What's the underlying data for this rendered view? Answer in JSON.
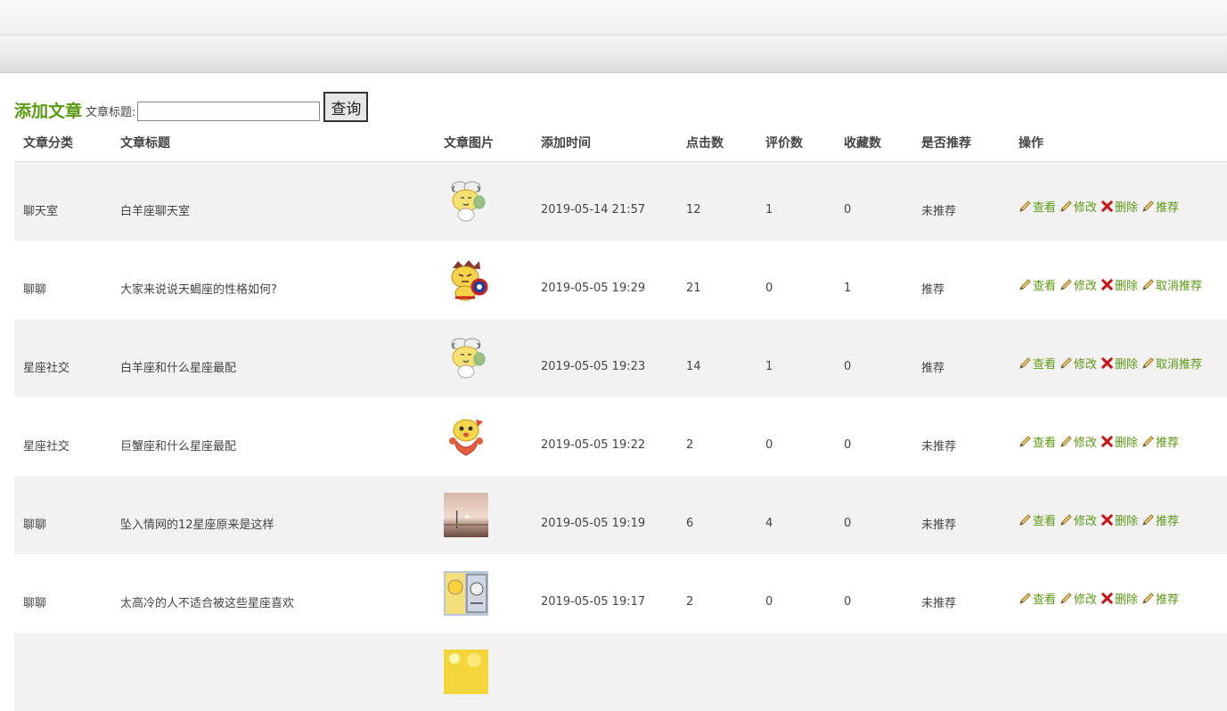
{
  "toolbar": {
    "add_article": "添加文章",
    "search_label": "文章标题:",
    "search_value": "",
    "search_button": "查询"
  },
  "columns": [
    "文章分类",
    "文章标题",
    "文章图片",
    "添加时间",
    "点击数",
    "评价数",
    "收藏数",
    "是否推荐",
    "操作"
  ],
  "rows": [
    {
      "category": "聊天室",
      "title": "白羊座聊天室",
      "image": "sheep-cartoon",
      "time": "2019-05-14 21:57",
      "clicks": "12",
      "reviews": "1",
      "favorites": "0",
      "recommended": "未推荐",
      "ops": [
        "查看",
        "修改",
        "删除",
        "推荐"
      ]
    },
    {
      "category": "聊聊",
      "title": "大家来说说天蝎座的性格如何?",
      "image": "captain-cartoon",
      "time": "2019-05-05 19:29",
      "clicks": "21",
      "reviews": "0",
      "favorites": "1",
      "recommended": "推荐",
      "ops": [
        "查看",
        "修改",
        "删除",
        "取消推荐"
      ]
    },
    {
      "category": "星座社交",
      "title": "白羊座和什么星座最配",
      "image": "sheep-cartoon",
      "time": "2019-05-05 19:23",
      "clicks": "14",
      "reviews": "1",
      "favorites": "0",
      "recommended": "推荐",
      "ops": [
        "查看",
        "修改",
        "删除",
        "取消推荐"
      ]
    },
    {
      "category": "星座社交",
      "title": "巨蟹座和什么星座最配",
      "image": "crab-cartoon",
      "time": "2019-05-05 19:22",
      "clicks": "2",
      "reviews": "0",
      "favorites": "0",
      "recommended": "未推荐",
      "ops": [
        "查看",
        "修改",
        "删除",
        "推荐"
      ]
    },
    {
      "category": "聊聊",
      "title": "坠入情网的12星座原来是这样",
      "image": "sunset-photo",
      "time": "2019-05-05 19:19",
      "clicks": "6",
      "reviews": "4",
      "favorites": "0",
      "recommended": "未推荐",
      "ops": [
        "查看",
        "修改",
        "删除",
        "推荐"
      ]
    },
    {
      "category": "聊聊",
      "title": "太高冷的人不适合被这些星座喜欢",
      "image": "comic-photo",
      "time": "2019-05-05 19:17",
      "clicks": "2",
      "reviews": "0",
      "favorites": "0",
      "recommended": "未推荐",
      "ops": [
        "查看",
        "修改",
        "删除",
        "推荐"
      ]
    },
    {
      "category": "",
      "title": "",
      "image": "yellow-cartoon",
      "time": "",
      "clicks": "",
      "reviews": "",
      "favorites": "",
      "recommended": "",
      "ops": []
    }
  ],
  "icons": {
    "view": "pencil-icon",
    "edit": "pencil-icon",
    "delete": "red-x-icon",
    "recommend": "pencil-icon"
  },
  "colors": {
    "accent": "#5a9a10",
    "delete": "#cc1111",
    "stripe": "#f2f2f2"
  }
}
